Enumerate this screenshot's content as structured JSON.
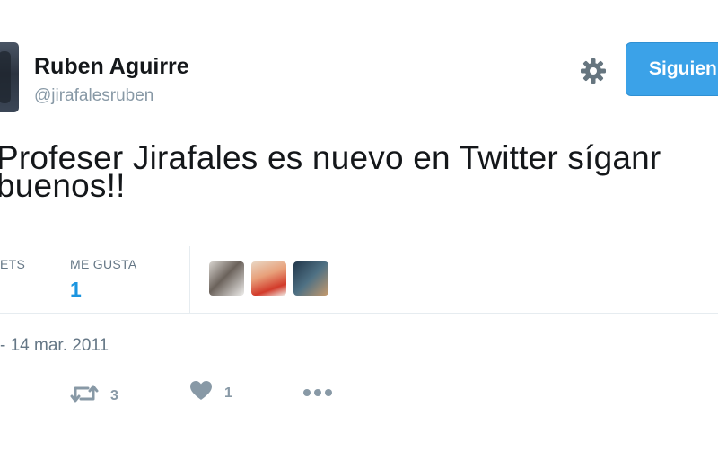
{
  "user": {
    "display_name": "Ruben Aguirre",
    "handle": "@jirafalesruben"
  },
  "header": {
    "follow_label": "Siguien"
  },
  "tweet": {
    "text_line1": "Profeser Jirafales es nuevo en Twitter síganr",
    "text_line2": "buenos!!"
  },
  "stats": {
    "retweets_label": "ETS",
    "likes_label": "ME GUSTA",
    "likes_count": "1"
  },
  "meta": {
    "date": "- 14 mar. 2011"
  },
  "actions": {
    "retweet_count": "3",
    "like_count": "1"
  },
  "colors": {
    "accent": "#1b95e0",
    "follow_button": "#3ba2e8",
    "muted_text": "#657786",
    "icon_gray": "#8899a6",
    "divider": "#e6ecf0"
  },
  "icons": [
    "gear-icon",
    "retweet-icon",
    "heart-icon",
    "more-icon"
  ]
}
